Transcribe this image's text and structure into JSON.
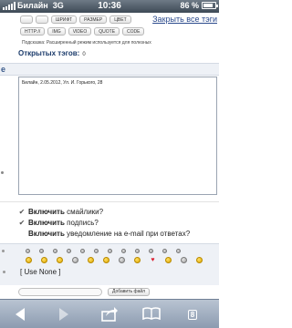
{
  "status": {
    "carrier": "Билайн",
    "network": "3G",
    "time": "10:36",
    "battery_text": "86 %",
    "battery_level": 0.86
  },
  "toolbar": {
    "row1": [
      "",
      "",
      "ШРИФТ",
      "РАЗМЕР",
      "ЦВЕТ"
    ],
    "row2": [
      "HTTP://",
      "IMG",
      "VIDEO",
      "QUOTE",
      "CODE"
    ]
  },
  "close_link": "Закрыть все тэги",
  "hint": "Подсказка: Расширенный режим используется для полезных",
  "open_tags": {
    "label": "Открытых тэгов:",
    "count": "0"
  },
  "section_letter": "е",
  "editor": {
    "value": "Билайн, 2.05.2012, Ул. И. Горького, 28"
  },
  "options": [
    {
      "bold": "Включить",
      "text": " смайлики?",
      "checked": true
    },
    {
      "bold": "Включить",
      "text": " подпись?",
      "checked": true
    },
    {
      "bold": "Включить",
      "text": " уведомление на e-mail при ответах?",
      "checked": false
    }
  ],
  "smileys": {
    "row1": [
      "grey-small",
      "grey-small",
      "grey-small",
      "grey-small",
      "grey-small",
      "grey-small",
      "grey-small",
      "grey-small",
      "grey-small",
      "grey-small",
      "grey-small",
      "grey-small"
    ],
    "row2": [
      "angry-smiley",
      "happy-smiley",
      "smile-smiley",
      "grey-smiley",
      "sad-smiley",
      "smile-smiley",
      "grey-smiley",
      "smile-smiley",
      "heart",
      "smile-smiley",
      "grey-smiley",
      "smile-smiley"
    ],
    "use_none": "[ Use None ]"
  },
  "attach": {
    "placeholder": "",
    "add_button": "Добавить файл"
  },
  "bottombar": {
    "tabs_count": "8"
  }
}
